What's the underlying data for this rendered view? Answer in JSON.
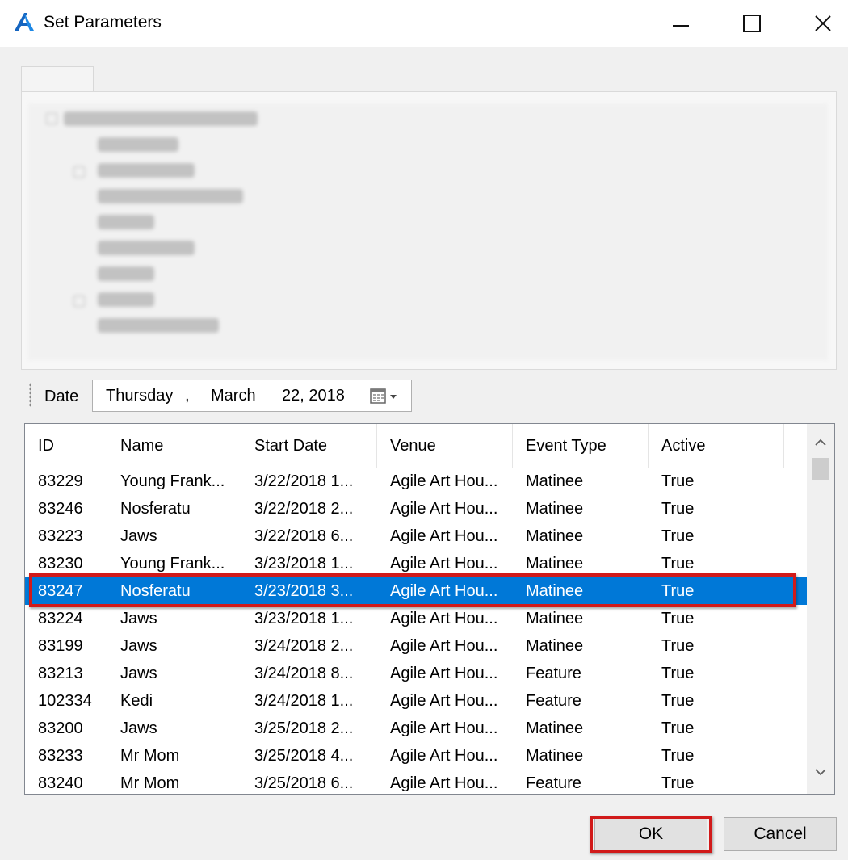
{
  "window": {
    "title": "Set Parameters",
    "icon": "agile-logo-icon"
  },
  "toolbar": {
    "date_label": "Date",
    "date_value": {
      "weekday": "Thursday",
      "comma": ",",
      "month": "March",
      "day_year": "22, 2018"
    }
  },
  "list": {
    "columns": [
      "ID",
      "Name",
      "Start Date",
      "Venue",
      "Event Type",
      "Active"
    ],
    "selected_index": 4,
    "rows": [
      [
        "83229",
        "Young Frank...",
        "3/22/2018 1...",
        "Agile Art Hou...",
        "Matinee",
        "True"
      ],
      [
        "83246",
        "Nosferatu",
        "3/22/2018 2...",
        "Agile Art Hou...",
        "Matinee",
        "True"
      ],
      [
        "83223",
        "Jaws",
        "3/22/2018 6...",
        "Agile Art Hou...",
        "Matinee",
        "True"
      ],
      [
        "83230",
        "Young Frank...",
        "3/23/2018 1...",
        "Agile Art Hou...",
        "Matinee",
        "True"
      ],
      [
        "83247",
        "Nosferatu",
        "3/23/2018 3...",
        "Agile Art Hou...",
        "Matinee",
        "True"
      ],
      [
        "83224",
        "Jaws",
        "3/23/2018 1...",
        "Agile Art Hou...",
        "Matinee",
        "True"
      ],
      [
        "83199",
        "Jaws",
        "3/24/2018 2...",
        "Agile Art Hou...",
        "Matinee",
        "True"
      ],
      [
        "83213",
        "Jaws",
        "3/24/2018 8...",
        "Agile Art Hou...",
        "Feature",
        "True"
      ],
      [
        "102334",
        "Kedi",
        "3/24/2018 1...",
        "Agile Art Hou...",
        "Feature",
        "True"
      ],
      [
        "83200",
        "Jaws",
        "3/25/2018 2...",
        "Agile Art Hou...",
        "Matinee",
        "True"
      ],
      [
        "83233",
        "Mr Mom",
        "3/25/2018 4...",
        "Agile Art Hou...",
        "Matinee",
        "True"
      ],
      [
        "83240",
        "Mr Mom",
        "3/25/2018 6...",
        "Agile Art Hou...",
        "Feature",
        "True"
      ]
    ]
  },
  "buttons": {
    "ok": "OK",
    "cancel": "Cancel"
  },
  "colors": {
    "selection": "#0078d7",
    "highlight": "#d11a1a"
  }
}
